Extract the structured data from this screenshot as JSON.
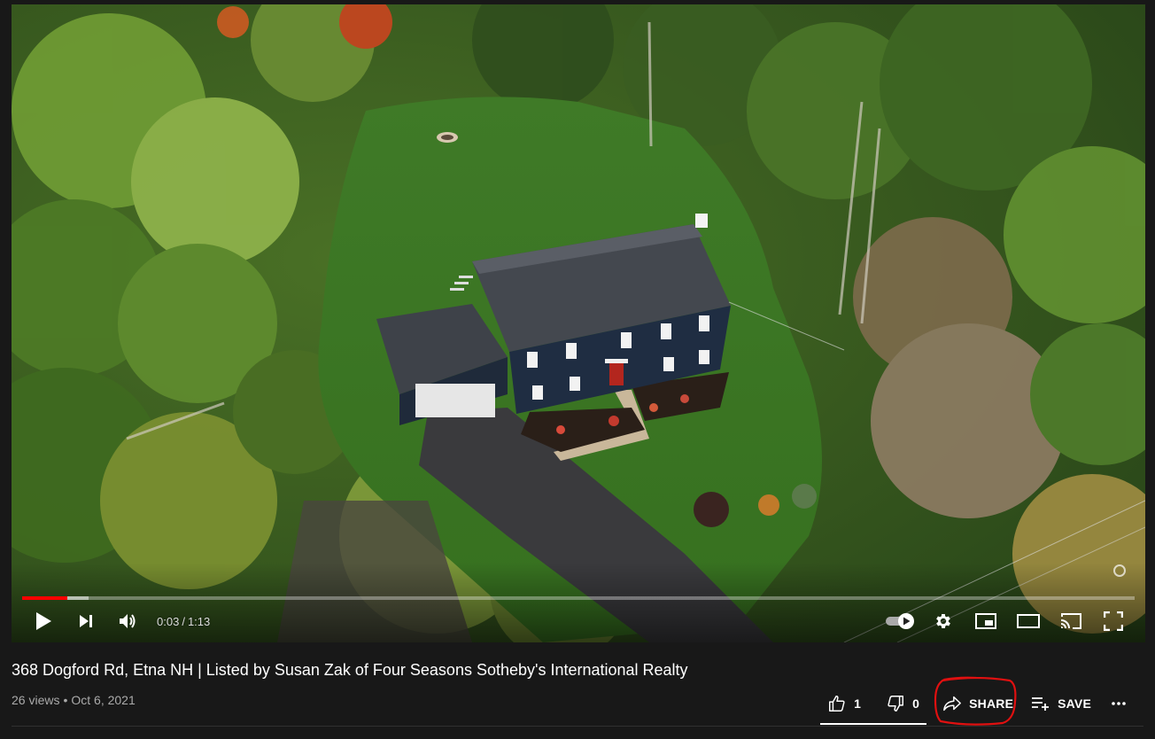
{
  "player": {
    "time_current": "0:03",
    "time_separator": "/",
    "time_total": "1:13",
    "progress_fraction": 0.041,
    "buffered_fraction": 0.06,
    "accent_color": "#ff0000"
  },
  "video": {
    "title": "368 Dogford Rd, Etna NH | Listed by Susan Zak of Four Seasons Sotheby's International Realty",
    "views": "26 views",
    "dot": "•",
    "date": "Oct 6, 2021"
  },
  "actions": {
    "like_count": "1",
    "dislike_count": "0",
    "share_label": "SHARE",
    "save_label": "SAVE",
    "more_label": "..."
  },
  "icons": {
    "play": "play-icon",
    "next": "next-icon",
    "volume": "volume-icon",
    "autoplay": "autoplay-toggle-icon",
    "settings": "gear-icon",
    "miniplayer": "miniplayer-icon",
    "theater": "theater-icon",
    "cast": "cast-icon",
    "fullscreen": "fullscreen-icon",
    "like": "thumbs-up-icon",
    "dislike": "thumbs-down-icon",
    "share": "share-arrow-icon",
    "save": "playlist-add-icon",
    "more": "more-horizontal-icon"
  },
  "annotation": {
    "color": "#e01010"
  }
}
